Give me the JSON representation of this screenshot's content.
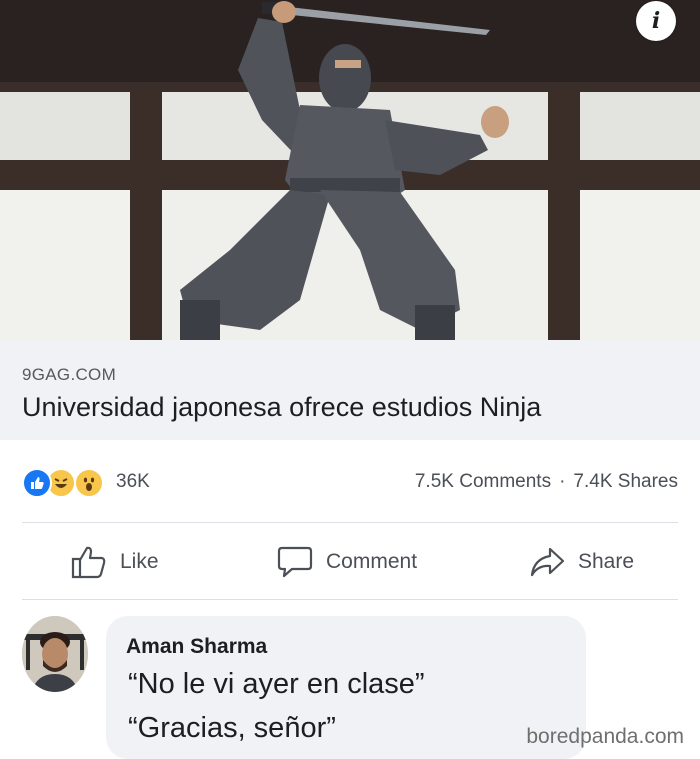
{
  "post": {
    "image_alt": "",
    "info_symbol": "i"
  },
  "link": {
    "domain": "9GAG.COM",
    "title": "Universidad japonesa ofrece estudios Ninja"
  },
  "stats": {
    "reaction_types": [
      "like",
      "haha",
      "wow"
    ],
    "reactions": "36K",
    "comments": "7.5K Comments",
    "separator": "·",
    "shares": "7.4K Shares"
  },
  "actions": {
    "like": "Like",
    "comment": "Comment",
    "share": "Share"
  },
  "comment": {
    "author": "Aman Sharma",
    "lines": [
      "“No le vi ayer en clase”",
      "“Gracias, señor”"
    ]
  },
  "watermark": "boredpanda.com",
  "colors": {
    "like_blue": "#1877f2",
    "emoji_yellow": "#f7c64a",
    "text_dark": "#1c1e21",
    "text_secondary": "#4b4f56",
    "panel_gray": "#f0f2f5"
  }
}
